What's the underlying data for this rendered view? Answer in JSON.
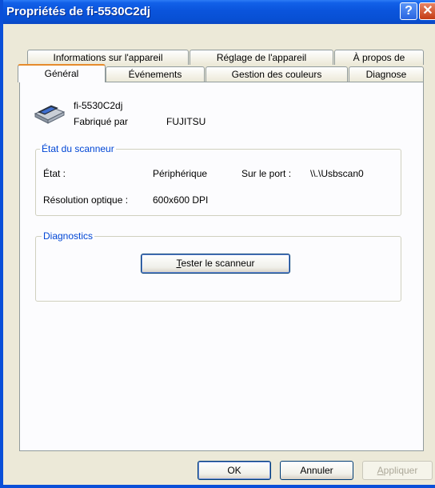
{
  "window": {
    "title": "Propriétés de fi-5530C2dj",
    "help_glyph": "?",
    "close_glyph": "✕"
  },
  "tabs": {
    "row1": [
      "Informations sur l'appareil",
      "Réglage de l'appareil",
      "À propos de"
    ],
    "row2": [
      "Général",
      "Événements",
      "Gestion des couleurs",
      "Diagnose"
    ],
    "active": "Général"
  },
  "device": {
    "icon": "scanner-icon",
    "name": "fi-5530C2dj",
    "manufacturer_label": "Fabriqué par",
    "manufacturer": "FUJITSU"
  },
  "status_group": {
    "title": "État du scanneur",
    "state_label": "État :",
    "state_value": "Périphérique",
    "port_label": "Sur le port :",
    "port_value": "\\\\.\\Usbscan0",
    "resolution_label": "Résolution optique :",
    "resolution_value": "600x600 DPI"
  },
  "diagnostics_group": {
    "title": "Diagnostics",
    "test_button_accel": "T",
    "test_button_rest": "ester le scanneur"
  },
  "footer": {
    "ok_label": "OK",
    "cancel_label": "Annuler",
    "apply_accel": "A",
    "apply_rest": "ppliquer"
  },
  "colors": {
    "titlebar": "#0a54dc",
    "group_title": "#0046d5",
    "active_tab_accent": "#e68b2c",
    "dialog_bg": "#ece9d8"
  }
}
